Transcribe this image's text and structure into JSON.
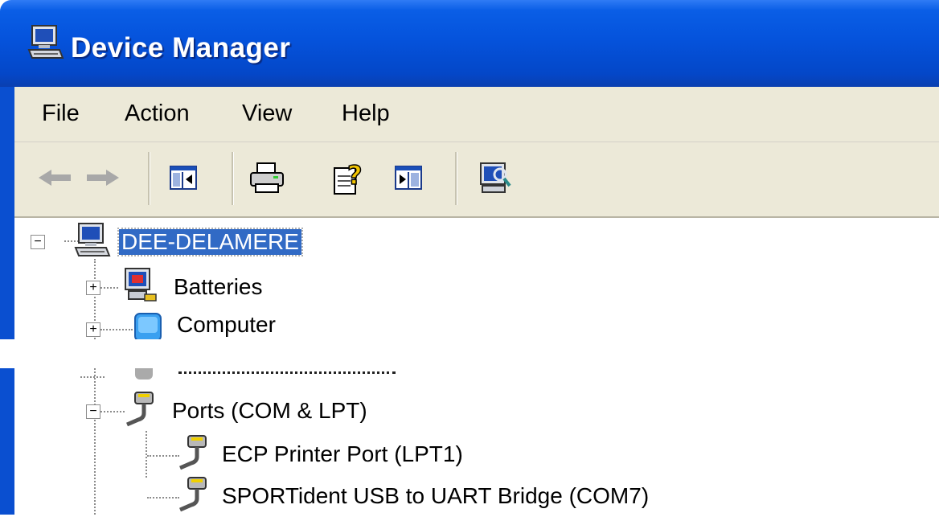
{
  "window": {
    "title": "Device Manager"
  },
  "menu": {
    "items": [
      "File",
      "Action",
      "View",
      "Help"
    ]
  },
  "toolbar": {
    "buttons": [
      "back-icon",
      "forward-icon",
      "show-hide-tree-icon",
      "print-icon",
      "help-icon",
      "properties-icon",
      "scan-hardware-icon"
    ]
  },
  "tree": {
    "root": "DEE-DELAMERE",
    "items": [
      "Batteries",
      "Computer"
    ],
    "ports": {
      "label": "Ports (COM & LPT)",
      "children": [
        "ECP Printer Port (LPT1)",
        "SPORTident USB to UART Bridge (COM7)"
      ]
    }
  },
  "colors": {
    "titlebar": "#0553dc",
    "selection": "#316ac5",
    "chrome": "#ece9d8"
  }
}
